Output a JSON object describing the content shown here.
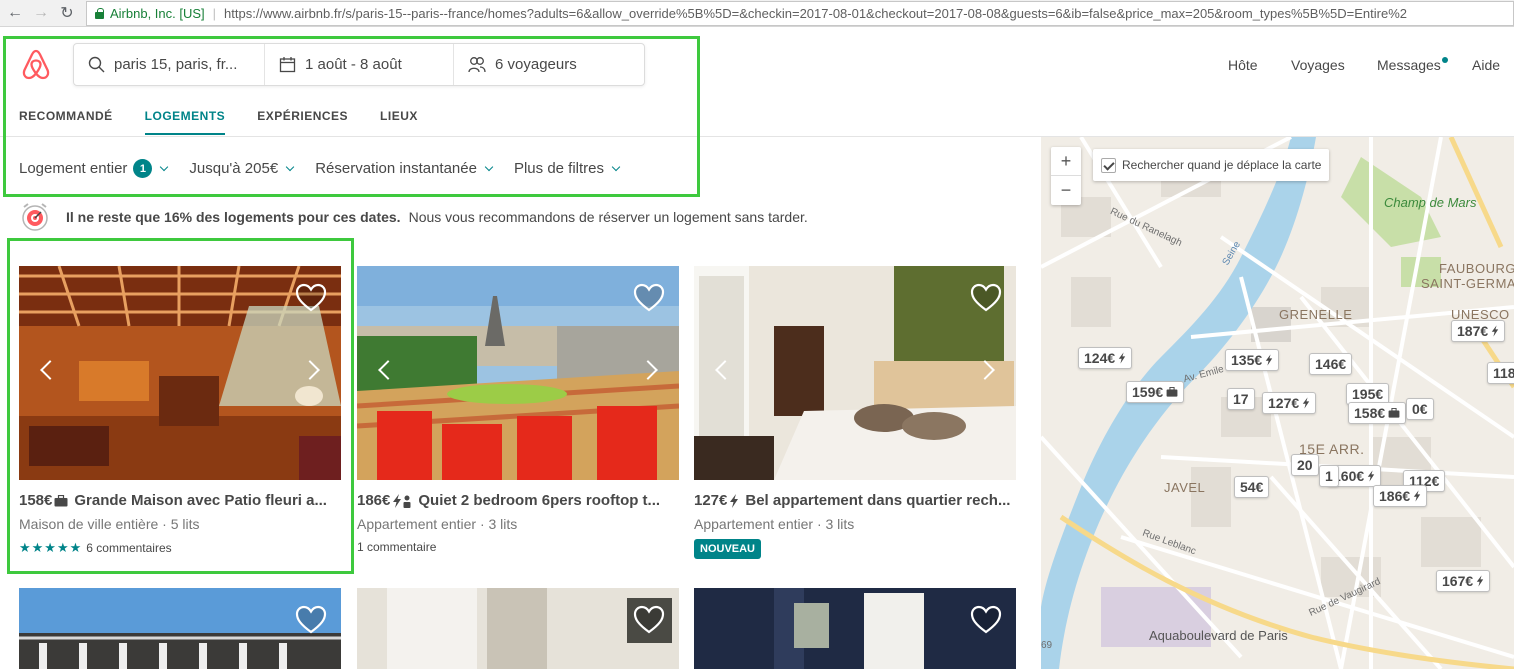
{
  "browser": {
    "secure_label": "Airbnb, Inc. [US]",
    "url": "https://www.airbnb.fr/s/paris-15--paris--france/homes?adults=6&allow_override%5B%5D=&checkin=2017-08-01&checkout=2017-08-08&guests=6&ib=false&price_max=205&room_types%5B%5D=Entire%2"
  },
  "search": {
    "location": "paris 15, paris, fr...",
    "dates": "1 août - 8 août",
    "guests": "6 voyageurs"
  },
  "topnav": [
    "Hôte",
    "Voyages",
    "Messages",
    "Aide"
  ],
  "tabs": [
    "RECOMMANDÉ",
    "LOGEMENTS",
    "EXPÉRIENCES",
    "LIEUX"
  ],
  "active_tab": "LOGEMENTS",
  "filters": {
    "room_type": "Logement entier",
    "room_type_count": "1",
    "price": "Jusqu'à 205€",
    "instant": "Réservation instantanée",
    "more": "Plus de filtres"
  },
  "notice": {
    "bold": "Il ne reste que 16% des logements pour ces dates.",
    "text": "Nous vous recommandons de réserver un logement sans tarder."
  },
  "listings": [
    {
      "price": "158€",
      "icon": "briefcase-icon",
      "title": "Grande Maison avec Patio fleuri a...",
      "subtitle": "Maison de ville entière · 5 lits",
      "stars": "★★★★★",
      "reviews": "6 commentaires"
    },
    {
      "price": "186€",
      "icon": "instant-book-and-business-icon",
      "title": "Quiet 2 bedroom 6pers rooftop t...",
      "subtitle": "Appartement entier · 3 lits",
      "reviews": "1 commentaire"
    },
    {
      "price": "127€",
      "icon": "instant-book-icon",
      "title": "Bel appartement dans quartier rech...",
      "subtitle": "Appartement entier · 3 lits",
      "tag": "NOUVEAU"
    }
  ],
  "map": {
    "search_on_move": "Rechercher quand je déplace la carte",
    "zoom_in": "+",
    "zoom_out": "−",
    "pins": [
      "124€",
      "159€",
      "135€",
      "146€",
      "127€",
      "17",
      "195€",
      "158€",
      "0€",
      "187€",
      "118",
      "20",
      "160€",
      "112€",
      "1",
      "54€",
      "186€",
      "167€"
    ],
    "labels": [
      "Champ de Mars",
      "FAUBOURG",
      "SAINT-GERMA",
      "GRENELLE",
      "UNESCO",
      "15E ARR.",
      "JAVEL",
      "Aquaboulevard de Paris",
      "Seine",
      "Rue Leblanc",
      "Rue de Vaugirard",
      "Rue du Ranelagh",
      "Av. Emile",
      "69"
    ]
  },
  "colors": {
    "brand": "#FF5A5F",
    "teal": "#008489",
    "highlight": "#3EC93E"
  }
}
